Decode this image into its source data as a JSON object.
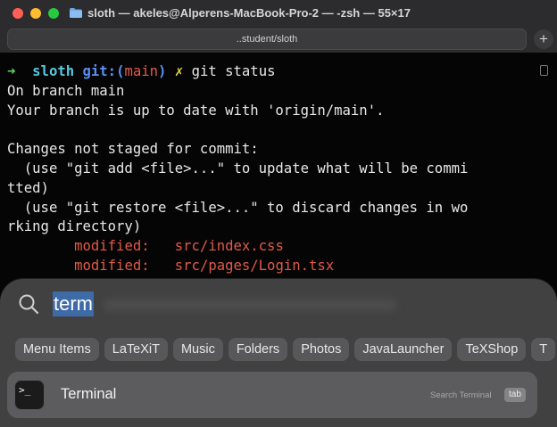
{
  "window": {
    "title": "sloth — akeles@Alperens-MacBook-Pro-2 — -zsh — 55×17",
    "tab_label": "..student/sloth",
    "new_tab_label": "+"
  },
  "terminal": {
    "prompt": {
      "arrow": "➜",
      "dir": "sloth",
      "git_prefix": "git:(",
      "branch": "main",
      "git_suffix": ")",
      "dirty_mark": "✗",
      "command": "git status"
    },
    "lines": [
      "On branch main",
      "Your branch is up to date with 'origin/main'.",
      "",
      "Changes not staged for commit:",
      "  (use \"git add <file>...\" to update what will be commi",
      "tted)",
      "  (use \"git restore <file>...\" to discard changes in wo",
      "rking directory)"
    ],
    "modified": [
      {
        "label": "modified:",
        "path": "src/index.css"
      },
      {
        "label": "modified:",
        "path": "src/pages/Login.tsx"
      }
    ]
  },
  "spotlight": {
    "query": "term",
    "categories": [
      "Menu Items",
      "LaTeXiT",
      "Music",
      "Folders",
      "Photos",
      "JavaLauncher",
      "TeXShop",
      "T"
    ],
    "result": {
      "name": "Terminal",
      "hint": "Search Terminal",
      "key": "tab",
      "icon_glyph": ">_"
    }
  },
  "colors": {
    "prompt_arrow": "#5bd75b",
    "prompt_dir": "#55c8e0",
    "git": "#5a8ff0",
    "branch": "#e55b4a",
    "dirty": "#e8d64a",
    "modified": "#e05a48",
    "selection": "#3e6aa8"
  },
  "icons": [
    "folder-icon",
    "search-icon",
    "terminal-app-icon"
  ]
}
